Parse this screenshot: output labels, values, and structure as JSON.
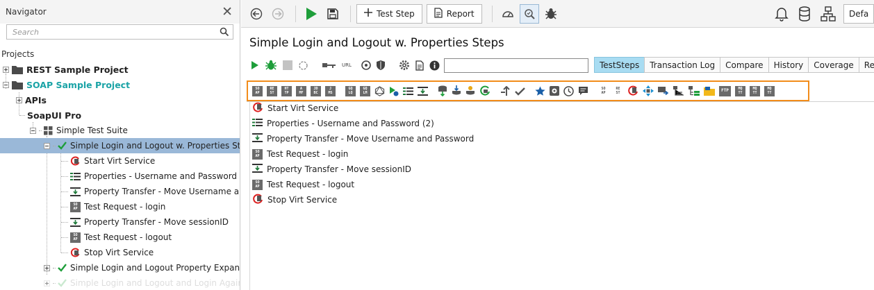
{
  "navigator": {
    "title": "Navigator",
    "search_placeholder": "Search",
    "projects_label": "Projects",
    "tree": [
      {
        "label": "REST Sample Project",
        "icon": "folder-icon"
      },
      {
        "label": "SOAP Sample Project",
        "icon": "folder-icon"
      },
      {
        "label": "APIs"
      },
      {
        "label": "SoapUI Pro"
      },
      {
        "label": "Simple Test Suite",
        "icon": "grid-icon"
      },
      {
        "label": "Simple Login and Logout w. Properties Ste...",
        "icon": "check-icon",
        "selected": true
      },
      {
        "label": "Start Virt Service",
        "icon": "virt-start-icon"
      },
      {
        "label": "Properties - Username and Password ...",
        "icon": "properties-icon"
      },
      {
        "label": "Property Transfer - Move Username a...",
        "icon": "transfer-icon"
      },
      {
        "label": "Test Request - login",
        "icon": "soap-request-icon"
      },
      {
        "label": "Property Transfer - Move sessionID",
        "icon": "transfer-icon"
      },
      {
        "label": "Test Request - logout",
        "icon": "soap-request-icon"
      },
      {
        "label": "Stop Virt Service",
        "icon": "virt-stop-icon"
      },
      {
        "label": "Simple Login and Logout Property Expansi...",
        "icon": "check-icon"
      },
      {
        "label": "Simple Login and Logout and Login Again",
        "icon": "check-icon"
      }
    ]
  },
  "toolbar": {
    "test_step_label": "Test Step",
    "report_label": "Report",
    "env_value": "Defa"
  },
  "testcase": {
    "title": "Simple Login and Logout w. Properties Steps",
    "url_label": "URL",
    "tabs": [
      "TestSteps",
      "Transaction Log",
      "Compare",
      "History",
      "Coverage",
      "Requirements"
    ],
    "active_tab": "TestSteps",
    "palette_labels": {
      "soap": [
        "SO",
        "AP"
      ],
      "rest": [
        "RE",
        "ST"
      ],
      "http": [
        "HT",
        "TP"
      ],
      "amf": [
        "A",
        "MF"
      ],
      "jdbc": [
        "JD",
        "BC"
      ],
      "jms": [
        "J",
        "MS"
      ],
      "graphql_query": [
        "GQ",
        "LQ"
      ],
      "graphql_mutation": [
        "GQ",
        "LM"
      ],
      "soap_mock": [
        "SO",
        "AP"
      ],
      "rest_mock": [
        "RE",
        "ST"
      ],
      "ftp": "FTP",
      "mqtt_publish": [
        "MQ",
        "TT"
      ],
      "mqtt_drop": [
        "MQ",
        "TT"
      ],
      "mqtt_receive": [
        "MQ",
        "TT"
      ]
    },
    "steps": [
      {
        "label": "Start Virt Service",
        "icon": "virt-start-icon"
      },
      {
        "label": "Properties - Username and Password (2)",
        "icon": "properties-icon"
      },
      {
        "label": "Property Transfer - Move Username and Password",
        "icon": "transfer-icon"
      },
      {
        "label": "Test Request - login",
        "icon": "soap-request-icon"
      },
      {
        "label": "Property Transfer - Move sessionID",
        "icon": "transfer-icon"
      },
      {
        "label": "Test Request - logout",
        "icon": "soap-request-icon"
      },
      {
        "label": "Stop Virt Service",
        "icon": "virt-stop-icon"
      }
    ]
  },
  "soap_icon_text": [
    "SO",
    "AP"
  ],
  "colors": {
    "accent_orange": "#f28c1a",
    "selected_row": "#9ab8d8",
    "active_tab": "#a8dcf2",
    "teal_project": "#1aa3a6",
    "run_green": "#1e9e3a"
  }
}
